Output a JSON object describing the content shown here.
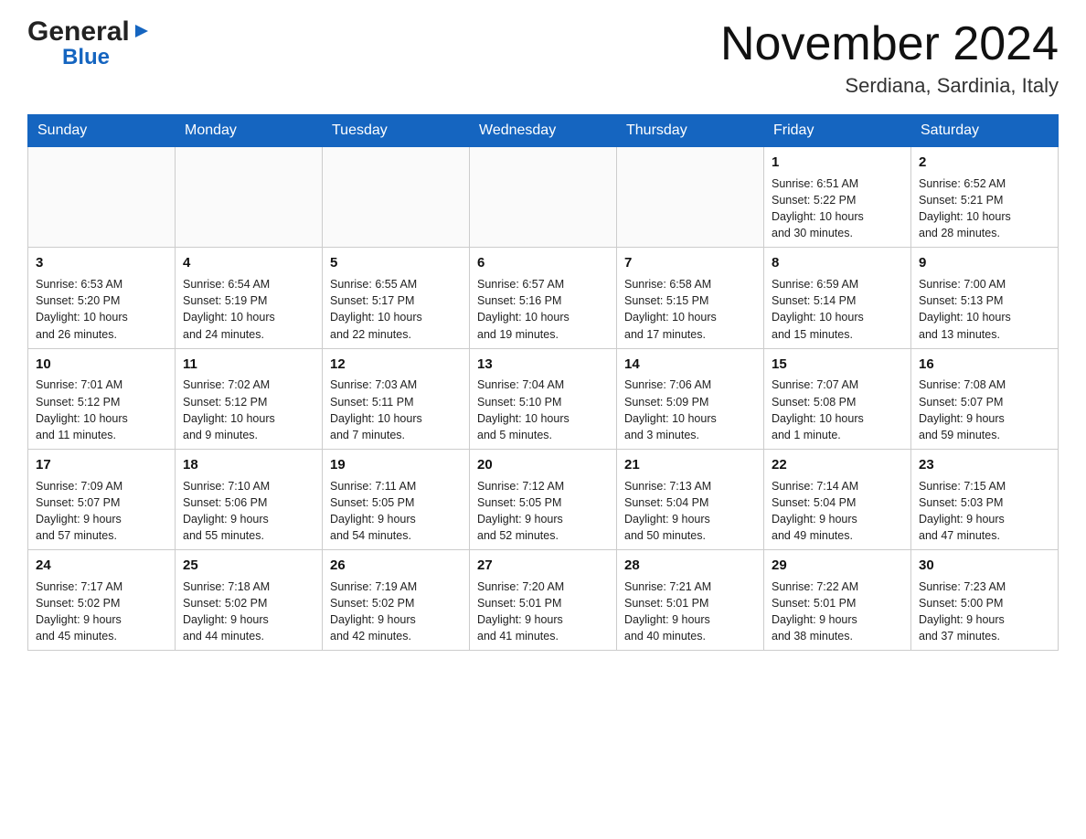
{
  "header": {
    "logo_general": "General",
    "logo_blue": "Blue",
    "month_title": "November 2024",
    "location": "Serdiana, Sardinia, Italy"
  },
  "days_of_week": [
    "Sunday",
    "Monday",
    "Tuesday",
    "Wednesday",
    "Thursday",
    "Friday",
    "Saturday"
  ],
  "weeks": [
    [
      {
        "day": "",
        "info": ""
      },
      {
        "day": "",
        "info": ""
      },
      {
        "day": "",
        "info": ""
      },
      {
        "day": "",
        "info": ""
      },
      {
        "day": "",
        "info": ""
      },
      {
        "day": "1",
        "info": "Sunrise: 6:51 AM\nSunset: 5:22 PM\nDaylight: 10 hours\nand 30 minutes."
      },
      {
        "day": "2",
        "info": "Sunrise: 6:52 AM\nSunset: 5:21 PM\nDaylight: 10 hours\nand 28 minutes."
      }
    ],
    [
      {
        "day": "3",
        "info": "Sunrise: 6:53 AM\nSunset: 5:20 PM\nDaylight: 10 hours\nand 26 minutes."
      },
      {
        "day": "4",
        "info": "Sunrise: 6:54 AM\nSunset: 5:19 PM\nDaylight: 10 hours\nand 24 minutes."
      },
      {
        "day": "5",
        "info": "Sunrise: 6:55 AM\nSunset: 5:17 PM\nDaylight: 10 hours\nand 22 minutes."
      },
      {
        "day": "6",
        "info": "Sunrise: 6:57 AM\nSunset: 5:16 PM\nDaylight: 10 hours\nand 19 minutes."
      },
      {
        "day": "7",
        "info": "Sunrise: 6:58 AM\nSunset: 5:15 PM\nDaylight: 10 hours\nand 17 minutes."
      },
      {
        "day": "8",
        "info": "Sunrise: 6:59 AM\nSunset: 5:14 PM\nDaylight: 10 hours\nand 15 minutes."
      },
      {
        "day": "9",
        "info": "Sunrise: 7:00 AM\nSunset: 5:13 PM\nDaylight: 10 hours\nand 13 minutes."
      }
    ],
    [
      {
        "day": "10",
        "info": "Sunrise: 7:01 AM\nSunset: 5:12 PM\nDaylight: 10 hours\nand 11 minutes."
      },
      {
        "day": "11",
        "info": "Sunrise: 7:02 AM\nSunset: 5:12 PM\nDaylight: 10 hours\nand 9 minutes."
      },
      {
        "day": "12",
        "info": "Sunrise: 7:03 AM\nSunset: 5:11 PM\nDaylight: 10 hours\nand 7 minutes."
      },
      {
        "day": "13",
        "info": "Sunrise: 7:04 AM\nSunset: 5:10 PM\nDaylight: 10 hours\nand 5 minutes."
      },
      {
        "day": "14",
        "info": "Sunrise: 7:06 AM\nSunset: 5:09 PM\nDaylight: 10 hours\nand 3 minutes."
      },
      {
        "day": "15",
        "info": "Sunrise: 7:07 AM\nSunset: 5:08 PM\nDaylight: 10 hours\nand 1 minute."
      },
      {
        "day": "16",
        "info": "Sunrise: 7:08 AM\nSunset: 5:07 PM\nDaylight: 9 hours\nand 59 minutes."
      }
    ],
    [
      {
        "day": "17",
        "info": "Sunrise: 7:09 AM\nSunset: 5:07 PM\nDaylight: 9 hours\nand 57 minutes."
      },
      {
        "day": "18",
        "info": "Sunrise: 7:10 AM\nSunset: 5:06 PM\nDaylight: 9 hours\nand 55 minutes."
      },
      {
        "day": "19",
        "info": "Sunrise: 7:11 AM\nSunset: 5:05 PM\nDaylight: 9 hours\nand 54 minutes."
      },
      {
        "day": "20",
        "info": "Sunrise: 7:12 AM\nSunset: 5:05 PM\nDaylight: 9 hours\nand 52 minutes."
      },
      {
        "day": "21",
        "info": "Sunrise: 7:13 AM\nSunset: 5:04 PM\nDaylight: 9 hours\nand 50 minutes."
      },
      {
        "day": "22",
        "info": "Sunrise: 7:14 AM\nSunset: 5:04 PM\nDaylight: 9 hours\nand 49 minutes."
      },
      {
        "day": "23",
        "info": "Sunrise: 7:15 AM\nSunset: 5:03 PM\nDaylight: 9 hours\nand 47 minutes."
      }
    ],
    [
      {
        "day": "24",
        "info": "Sunrise: 7:17 AM\nSunset: 5:02 PM\nDaylight: 9 hours\nand 45 minutes."
      },
      {
        "day": "25",
        "info": "Sunrise: 7:18 AM\nSunset: 5:02 PM\nDaylight: 9 hours\nand 44 minutes."
      },
      {
        "day": "26",
        "info": "Sunrise: 7:19 AM\nSunset: 5:02 PM\nDaylight: 9 hours\nand 42 minutes."
      },
      {
        "day": "27",
        "info": "Sunrise: 7:20 AM\nSunset: 5:01 PM\nDaylight: 9 hours\nand 41 minutes."
      },
      {
        "day": "28",
        "info": "Sunrise: 7:21 AM\nSunset: 5:01 PM\nDaylight: 9 hours\nand 40 minutes."
      },
      {
        "day": "29",
        "info": "Sunrise: 7:22 AM\nSunset: 5:01 PM\nDaylight: 9 hours\nand 38 minutes."
      },
      {
        "day": "30",
        "info": "Sunrise: 7:23 AM\nSunset: 5:00 PM\nDaylight: 9 hours\nand 37 minutes."
      }
    ]
  ]
}
